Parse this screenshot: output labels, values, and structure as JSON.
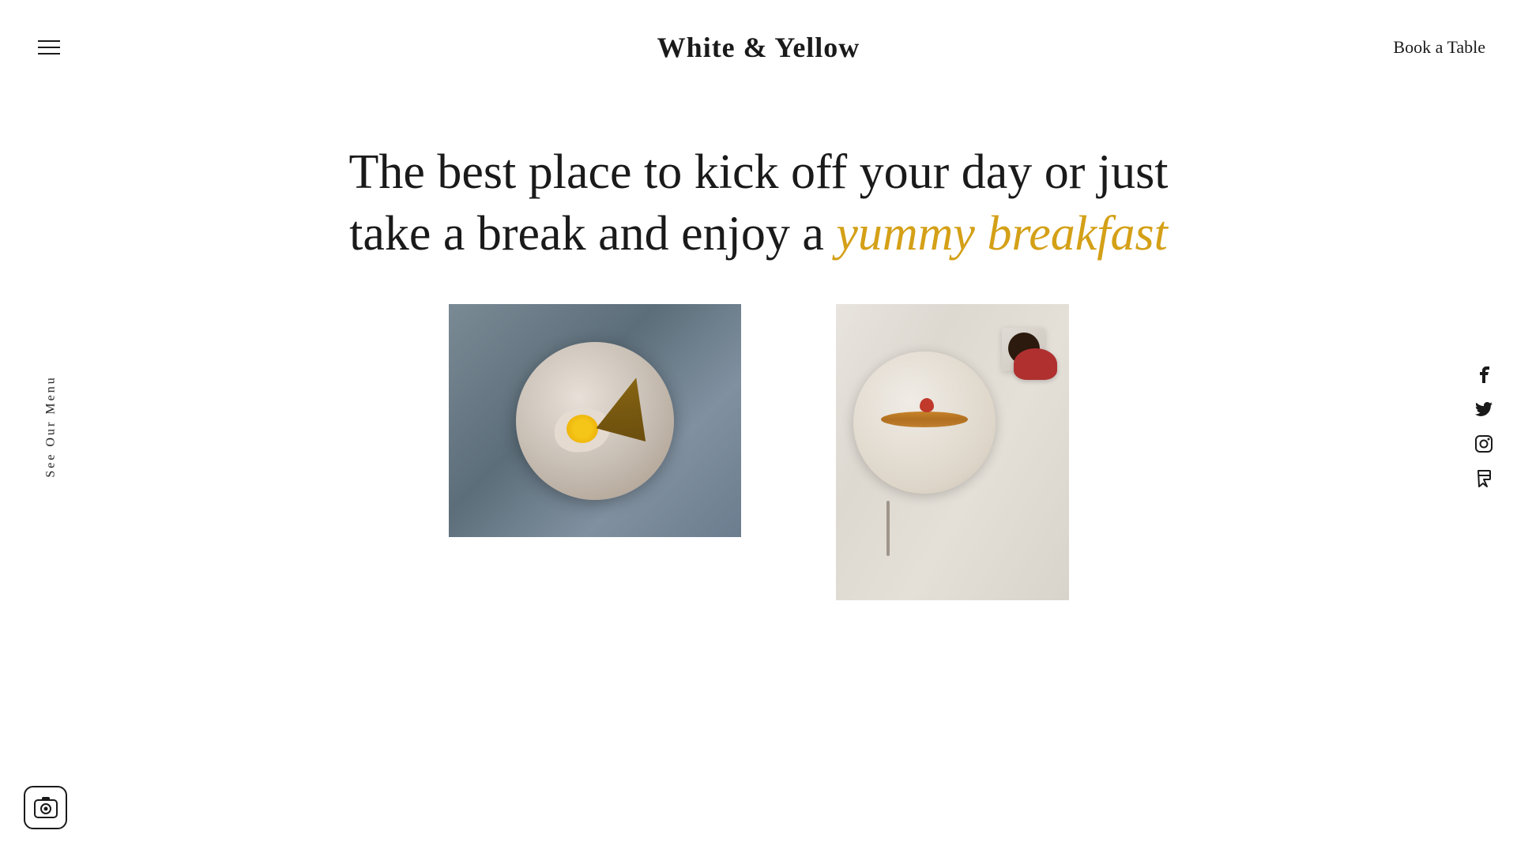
{
  "header": {
    "logo": "White & Yellow",
    "book_table": "Book a Table",
    "hamburger_label": "Menu"
  },
  "hero": {
    "text_line1": "The best place to kick off your day or just",
    "text_line2_plain": "take a break and enjoy a ",
    "text_line2_highlight": "yummy breakfast",
    "accent_color": "#d4a017"
  },
  "sidebar": {
    "menu_text": "See Our Menu"
  },
  "social": {
    "facebook": "f",
    "twitter": "𝕏",
    "instagram": "◎",
    "foursquare": "F"
  },
  "images": {
    "image1_alt": "Breakfast plate with fried egg and toast",
    "image2_alt": "Pancakes with strawberries and coffee"
  },
  "camera": {
    "label": "Camera"
  }
}
